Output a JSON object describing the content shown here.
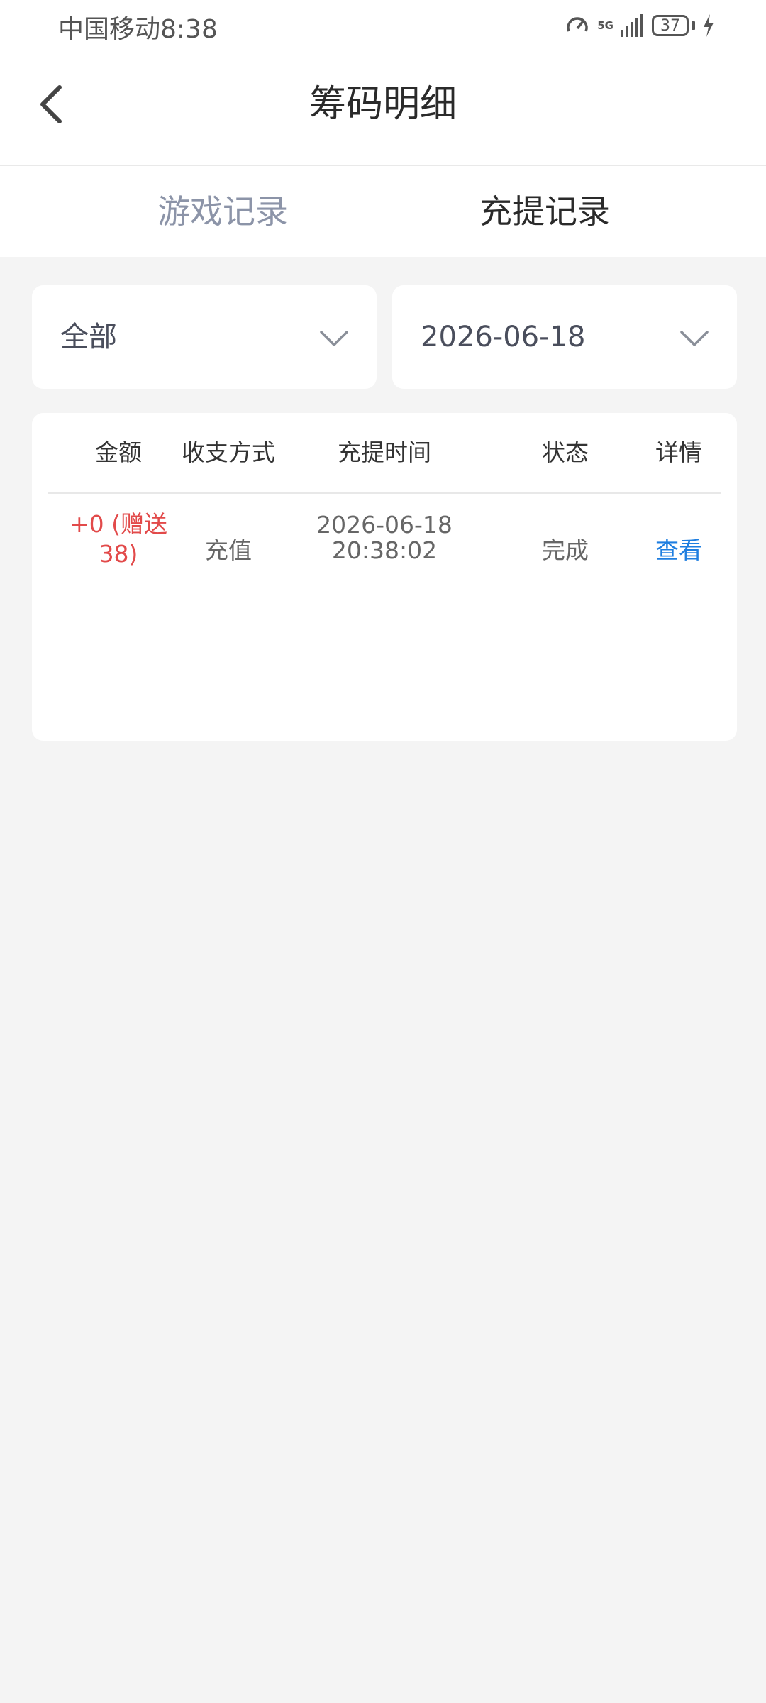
{
  "statusbar": {
    "carrier": "中国移动",
    "time": "8:38",
    "network": "5G",
    "battery": "37"
  },
  "header": {
    "title": "筹码明细"
  },
  "tabs": [
    {
      "label": "游戏记录",
      "active": false
    },
    {
      "label": "充提记录",
      "active": true
    }
  ],
  "filters": {
    "type": "全部",
    "date": "2026-06-18"
  },
  "table": {
    "headers": [
      "金额",
      "收支方式",
      "充提时间",
      "状态",
      "详情"
    ],
    "rows": [
      {
        "amount_line1": "+0 (赠送",
        "amount_line2": "38)",
        "method": "充值",
        "date": "2026-06-18",
        "clock": "20:38:02",
        "status": "完成",
        "detail": "查看"
      }
    ]
  },
  "colors": {
    "accent_link": "#1e7ee0",
    "amount_red": "#e24a4a",
    "inactive_tab": "#8c94a8",
    "background": "#f4f4f4"
  }
}
